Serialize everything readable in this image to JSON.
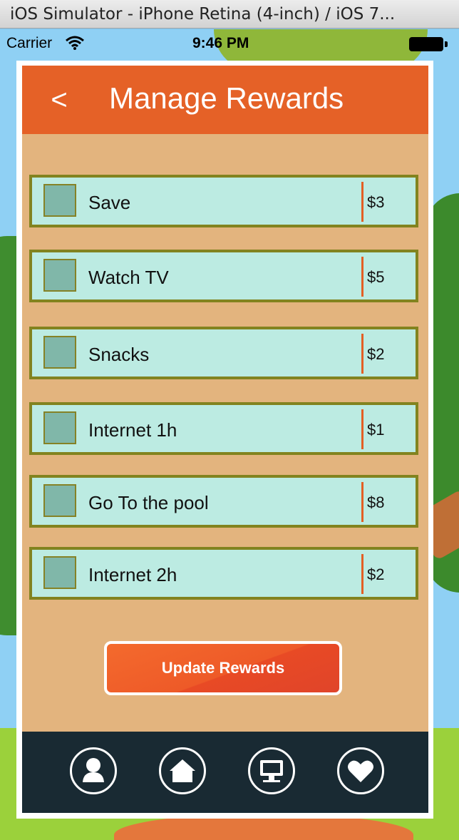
{
  "simulator": {
    "title": "iOS Simulator - iPhone Retina (4-inch) / iOS 7..."
  },
  "status_bar": {
    "carrier": "Carrier",
    "time": "9:46 PM"
  },
  "nav": {
    "back_icon": "chevron-left-icon",
    "back_glyph": "<",
    "title": "Manage Rewards"
  },
  "rewards": [
    {
      "label": "Save",
      "price": "$3",
      "checked": false
    },
    {
      "label": "Watch TV",
      "price": "$5",
      "checked": false
    },
    {
      "label": "Snacks",
      "price": "$2",
      "checked": false
    },
    {
      "label": "Internet 1h",
      "price": "$1",
      "checked": false
    },
    {
      "label": "Go To the pool",
      "price": "$8",
      "checked": false
    },
    {
      "label": "Internet 2h",
      "price": "$2",
      "checked": false
    }
  ],
  "update_button": {
    "label": "Update Rewards"
  },
  "tab_bar": {
    "tabs": [
      {
        "icon": "person-icon"
      },
      {
        "icon": "home-icon"
      },
      {
        "icon": "computer-icon"
      },
      {
        "icon": "heart-icon"
      }
    ]
  },
  "colors": {
    "nav_bar": "#e56127",
    "panel_bg": "#e3b47e",
    "row_bg": "#bcebe2",
    "row_border": "#82831f",
    "divider": "#e35f24",
    "tab_bar": "#192a33"
  }
}
